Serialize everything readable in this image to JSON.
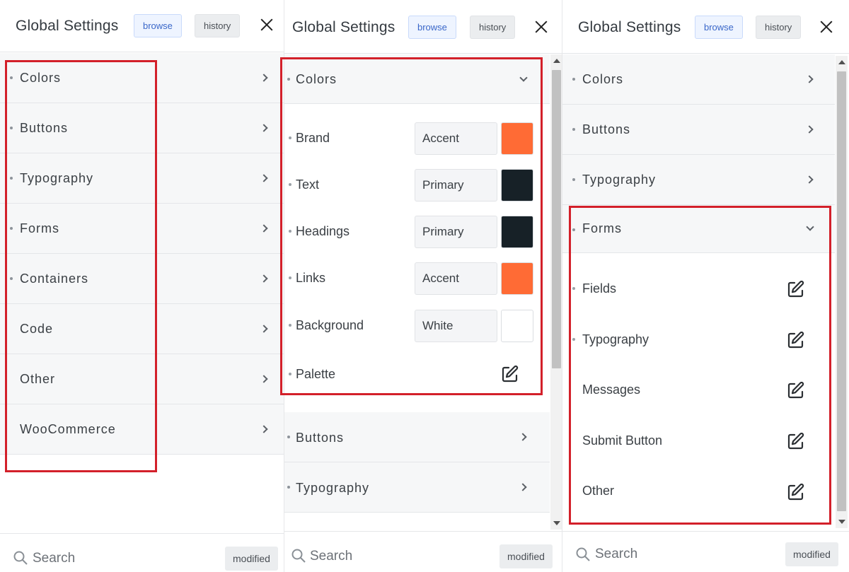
{
  "panels": [
    {
      "header": {
        "title": "Global Settings",
        "browse": "browse",
        "history": "history"
      },
      "items": [
        {
          "label": "Colors"
        },
        {
          "label": "Buttons"
        },
        {
          "label": "Typography"
        },
        {
          "label": "Forms"
        },
        {
          "label": "Containers"
        },
        {
          "label": "Code"
        },
        {
          "label": "Other"
        },
        {
          "label": "WooCommerce"
        }
      ],
      "footer": {
        "search": "Search",
        "modified": "modified"
      }
    },
    {
      "header": {
        "title": "Global Settings",
        "browse": "browse",
        "history": "history"
      },
      "expanded": {
        "label": "Colors",
        "rows": [
          {
            "label": "Brand",
            "value": "Accent",
            "color": "#ff6b35"
          },
          {
            "label": "Text",
            "value": "Primary",
            "color": "#172127"
          },
          {
            "label": "Headings",
            "value": "Primary",
            "color": "#172127"
          },
          {
            "label": "Links",
            "value": "Accent",
            "color": "#ff6b35"
          },
          {
            "label": "Background",
            "value": "White",
            "color": "#ffffff"
          }
        ],
        "palette": "Palette"
      },
      "items": [
        {
          "label": "Buttons"
        },
        {
          "label": "Typography"
        }
      ],
      "footer": {
        "search": "Search",
        "modified": "modified"
      }
    },
    {
      "header": {
        "title": "Global Settings",
        "browse": "browse",
        "history": "history"
      },
      "items": [
        {
          "label": "Colors"
        },
        {
          "label": "Buttons"
        },
        {
          "label": "Typography"
        }
      ],
      "expanded": {
        "label": "Forms",
        "subitems": [
          {
            "label": "Fields"
          },
          {
            "label": "Typography"
          },
          {
            "label": "Messages"
          },
          {
            "label": "Submit Button"
          },
          {
            "label": "Other"
          }
        ]
      },
      "footer": {
        "search": "Search",
        "modified": "modified"
      }
    }
  ],
  "icons": {
    "edit": "edit-icon",
    "search": "search-icon",
    "close": "close-icon",
    "chevron": "chevron-right-icon"
  }
}
